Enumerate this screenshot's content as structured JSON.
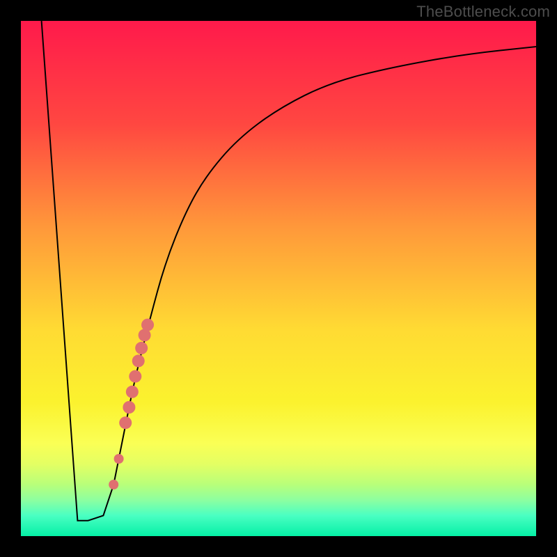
{
  "attribution": "TheBottleneck.com",
  "chart_data": {
    "type": "line",
    "title": "",
    "xlabel": "",
    "ylabel": "",
    "xlim": [
      0,
      100
    ],
    "ylim": [
      0,
      100
    ],
    "grid": false,
    "legend": false,
    "background_gradient": [
      {
        "y": 0,
        "color": "#ff1a4b"
      },
      {
        "y": 20,
        "color": "#ff4741"
      },
      {
        "y": 40,
        "color": "#ff983a"
      },
      {
        "y": 60,
        "color": "#ffdb33"
      },
      {
        "y": 74,
        "color": "#fbf22e"
      },
      {
        "y": 82,
        "color": "#faff55"
      },
      {
        "y": 86,
        "color": "#e4ff63"
      },
      {
        "y": 90,
        "color": "#b8ff7a"
      },
      {
        "y": 93,
        "color": "#8dffa0"
      },
      {
        "y": 96,
        "color": "#4affc2"
      },
      {
        "y": 100,
        "color": "#05f0a6"
      }
    ],
    "series": [
      {
        "name": "bottleneck-curve",
        "color": "#000000",
        "x": [
          4,
          11,
          13,
          16,
          18,
          20,
          22,
          25,
          28,
          32,
          36,
          42,
          50,
          60,
          72,
          86,
          100
        ],
        "y": [
          100,
          3,
          3,
          4,
          10,
          20,
          30,
          42,
          53,
          63,
          70,
          77,
          83,
          88,
          91,
          93.5,
          95
        ]
      }
    ],
    "marker_series": {
      "name": "highlight-points",
      "color": "#e07070",
      "radius_small": 7,
      "radius_large": 9,
      "points": [
        {
          "x": 18.0,
          "y": 10,
          "r": "small"
        },
        {
          "x": 19.0,
          "y": 15,
          "r": "small"
        },
        {
          "x": 20.3,
          "y": 22,
          "r": "large"
        },
        {
          "x": 21.0,
          "y": 25,
          "r": "large"
        },
        {
          "x": 21.6,
          "y": 28,
          "r": "large"
        },
        {
          "x": 22.2,
          "y": 31,
          "r": "large"
        },
        {
          "x": 22.8,
          "y": 34,
          "r": "large"
        },
        {
          "x": 23.4,
          "y": 36.5,
          "r": "large"
        },
        {
          "x": 24.0,
          "y": 39,
          "r": "large"
        },
        {
          "x": 24.6,
          "y": 41,
          "r": "large"
        }
      ]
    }
  }
}
